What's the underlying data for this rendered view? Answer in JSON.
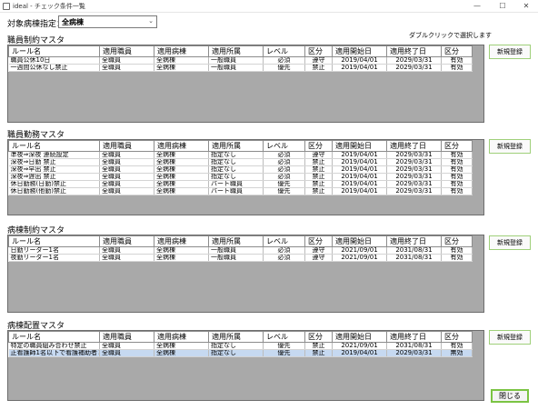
{
  "window": {
    "title": "ideal - チェック条件一覧",
    "minimize": "—",
    "maximize": "☐",
    "close": "✕"
  },
  "filter": {
    "label": "対象病棟指定：",
    "value": "全病棟",
    "chevron": "⌄"
  },
  "hint": "ダブルクリックで選択します",
  "columns": [
    "ルール名",
    "適用職員",
    "適用病棟",
    "適用所属",
    "レベル",
    "区分",
    "適用開始日",
    "適用終了日",
    "区分"
  ],
  "sections": [
    {
      "title": "職員制約マスタ",
      "new_button": "新規登録",
      "rows": [
        [
          "職員公休10日",
          "全職員",
          "全病棟",
          "一般職員",
          "必須",
          "遵守",
          "2019/04/01",
          "2029/03/31",
          "有効"
        ],
        [
          "一週間公休なし禁止",
          "全職員",
          "全病棟",
          "一般職員",
          "優先",
          "禁止",
          "2019/04/01",
          "2029/03/31",
          "有効"
        ]
      ]
    },
    {
      "title": "職員勤務マスタ",
      "new_button": "新規登録",
      "rows": [
        [
          "準夜⇒深夜 連続設定",
          "全職員",
          "全病棟",
          "指定なし",
          "必須",
          "遵守",
          "2019/04/01",
          "2029/03/31",
          "有効"
        ],
        [
          "深夜⇒日勤 禁止",
          "全職員",
          "全病棟",
          "指定なし",
          "必須",
          "禁止",
          "2019/04/01",
          "2029/03/31",
          "有効"
        ],
        [
          "深夜⇒早出 禁止",
          "全職員",
          "全病棟",
          "指定なし",
          "必須",
          "禁止",
          "2019/04/01",
          "2029/03/31",
          "有効"
        ],
        [
          "深夜⇒遅出 禁止",
          "全職員",
          "全病棟",
          "指定なし",
          "必須",
          "禁止",
          "2019/04/01",
          "2029/03/31",
          "有効"
        ],
        [
          "休日勤務(日勤)禁止",
          "全職員",
          "全病棟",
          "パート職員",
          "優先",
          "禁止",
          "2019/04/01",
          "2029/03/31",
          "有効"
        ],
        [
          "休日勤務(他勤)禁止",
          "全職員",
          "全病棟",
          "パート職員",
          "優先",
          "禁止",
          "2019/04/01",
          "2029/03/31",
          "有効"
        ]
      ]
    },
    {
      "title": "病棟制約マスタ",
      "new_button": "新規登録",
      "rows": [
        [
          "日勤リーダー1名",
          "全職員",
          "全病棟",
          "一般職員",
          "必須",
          "遵守",
          "2021/09/01",
          "2031/08/31",
          "有効"
        ],
        [
          "夜勤リーダー1名",
          "全職員",
          "全病棟",
          "一般職員",
          "必須",
          "遵守",
          "2021/09/01",
          "2031/08/31",
          "有効"
        ]
      ]
    },
    {
      "title": "病棟配置マスタ",
      "new_button": "新規登録",
      "rows": [
        [
          "特定の職員組み合わせ禁止",
          "全職員",
          "全病棟",
          "指定なし",
          "優先",
          "禁止",
          "2021/09/01",
          "2031/08/31",
          "有効"
        ],
        [
          "正看護師1名以下で看護補助者３名以上禁止",
          "全職員",
          "全病棟",
          "指定なし",
          "優先",
          "禁止",
          "2019/04/01",
          "2029/03/31",
          "無効"
        ]
      ]
    }
  ],
  "close_button": "閉じる"
}
